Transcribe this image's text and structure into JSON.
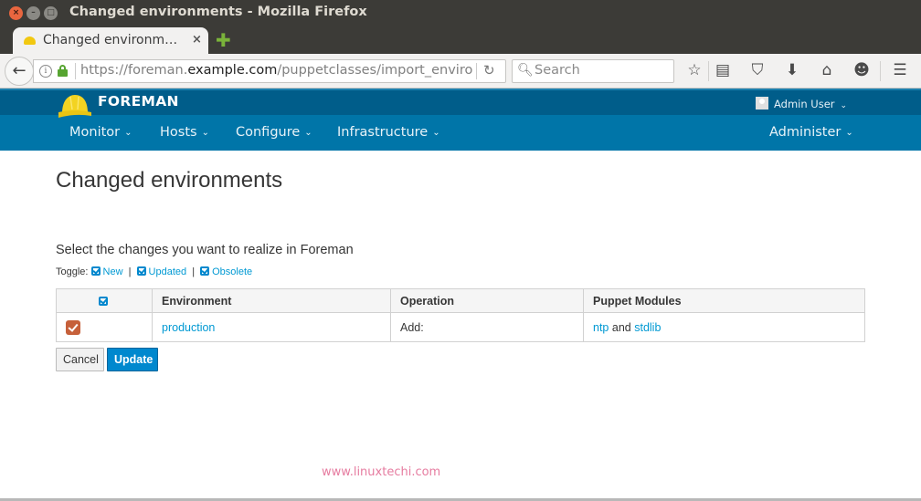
{
  "window": {
    "title": "Changed environments - Mozilla Firefox",
    "buttons": {
      "close": "×",
      "minimize": "–",
      "maximize": "□"
    }
  },
  "tabs": [
    {
      "label": "Changed environm…",
      "close": "×",
      "icon": "foreman-hat-icon",
      "active": true
    }
  ],
  "new_tab": "✚",
  "navbar": {
    "back": "←",
    "url_prefix": "https://foreman.",
    "url_domain": "example.com",
    "url_path": "/puppetclasses/import_enviro",
    "reload": "↻",
    "search_placeholder": "Search",
    "search_glyph": "⚲",
    "icons": [
      {
        "name": "bookmark-star-icon",
        "glyph": "☆"
      },
      {
        "name": "reading-list-icon",
        "glyph": "▤"
      },
      {
        "name": "pocket-icon",
        "glyph": "⛉"
      },
      {
        "name": "downloads-icon",
        "glyph": "⬇"
      },
      {
        "name": "home-icon",
        "glyph": "⌂"
      },
      {
        "name": "hello-icon",
        "glyph": "☻"
      },
      {
        "name": "menu-icon",
        "glyph": "☰"
      }
    ]
  },
  "foreman": {
    "brand": "FOREMAN",
    "user": "Admin User",
    "chevron": "⌄",
    "nav": [
      {
        "label": "Monitor"
      },
      {
        "label": "Hosts"
      },
      {
        "label": "Configure"
      },
      {
        "label": "Infrastructure"
      }
    ],
    "nav_right": {
      "label": "Administer"
    },
    "colors": {
      "top_bar": "#005d8a",
      "nav_bar": "#0075a8",
      "link": "#0099d3",
      "primary_button": "#0088ce"
    }
  },
  "content": {
    "title": "Changed environments",
    "subtitle": "Select the changes you want to realize in Foreman",
    "toggle_label": "Toggle:",
    "toggles": [
      {
        "label": "New"
      },
      {
        "label": "Updated"
      },
      {
        "label": "Obsolete"
      }
    ],
    "toggle_separator": "|",
    "table": {
      "headers": [
        "",
        "Environment",
        "Operation",
        "Puppet Modules"
      ],
      "rows": [
        {
          "checked": true,
          "environment": "production",
          "operation": "Add:",
          "modules": [
            "ntp",
            "stdlib"
          ],
          "modules_join": "and"
        }
      ]
    },
    "buttons": {
      "cancel": "Cancel",
      "update": "Update"
    }
  },
  "watermark": "www.linuxtechi.com"
}
